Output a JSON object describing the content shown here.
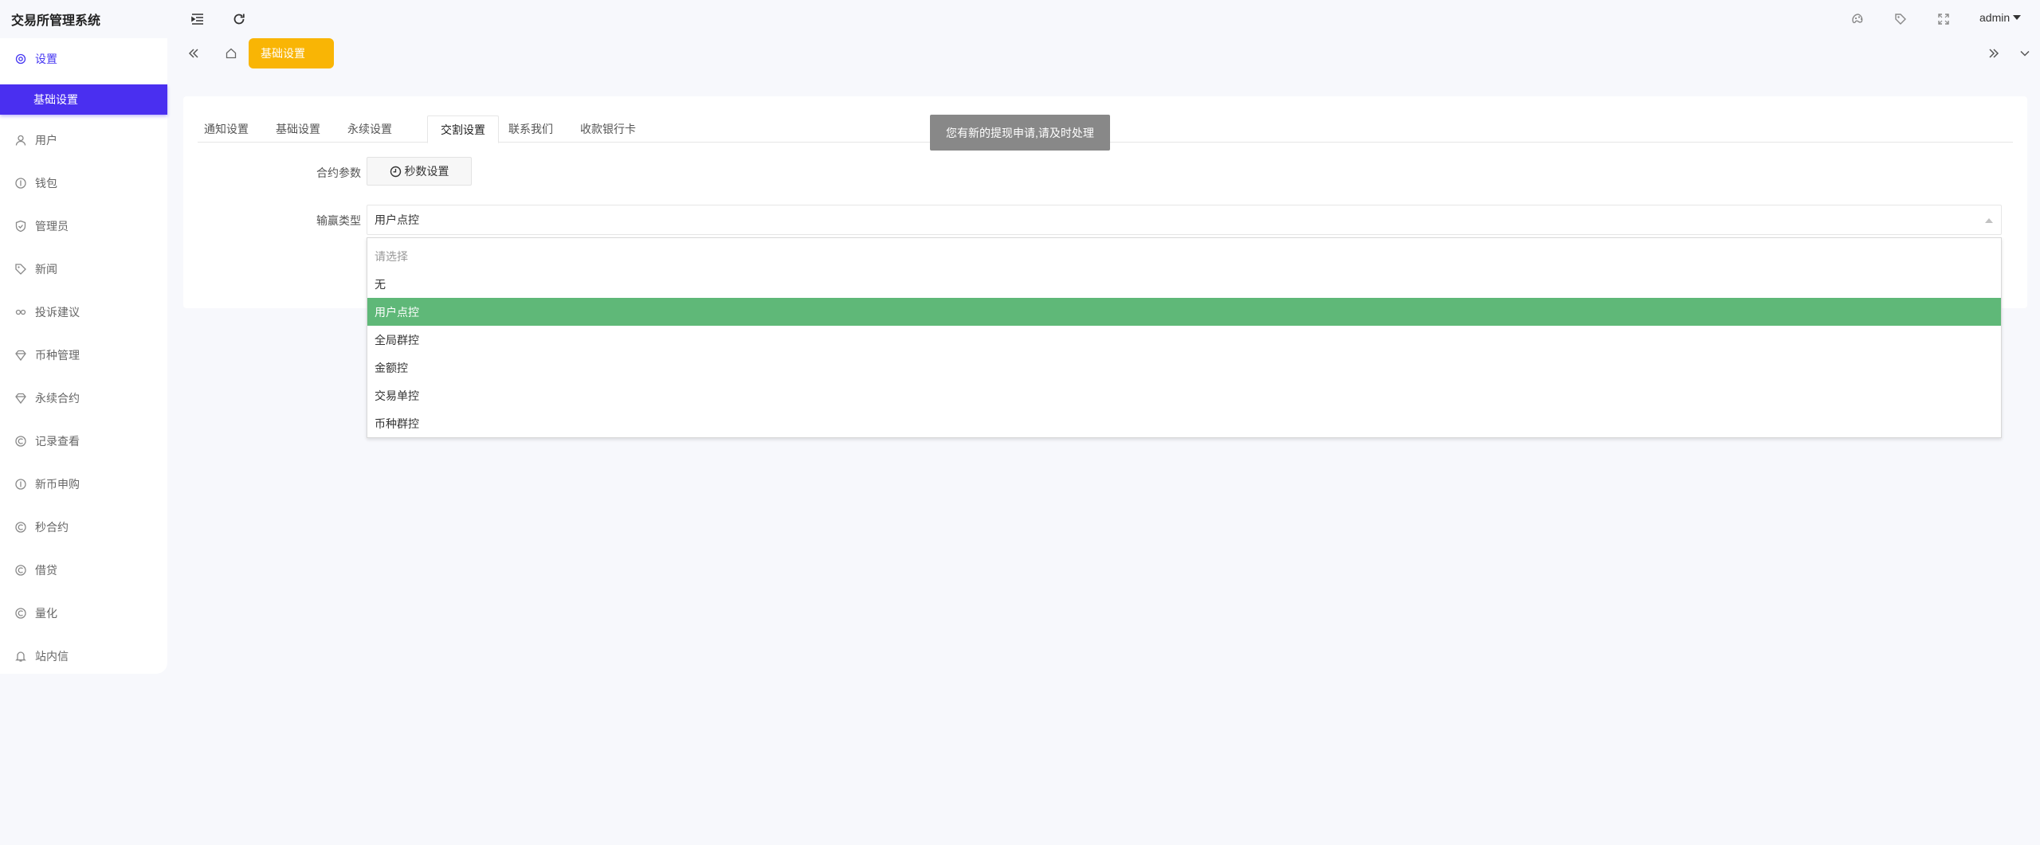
{
  "app": {
    "title": "交易所管理系统"
  },
  "header": {
    "icons": [
      "menu-fold-icon",
      "refresh-icon",
      "theme-icon",
      "tag-icon",
      "fullscreen-icon"
    ],
    "user": "admin"
  },
  "sidebar": {
    "top": {
      "label": "设置",
      "icon": "gear-icon"
    },
    "sub": {
      "label": "基础设置"
    },
    "items": [
      {
        "label": "用户",
        "icon": "user-icon"
      },
      {
        "label": "钱包",
        "icon": "coin-icon"
      },
      {
        "label": "管理员",
        "icon": "shield-icon"
      },
      {
        "label": "新闻",
        "icon": "tag-icon"
      },
      {
        "label": "投诉建议",
        "icon": "link-icon"
      },
      {
        "label": "币种管理",
        "icon": "diamond-icon"
      },
      {
        "label": "永续合约",
        "icon": "diamond-icon"
      },
      {
        "label": "记录查看",
        "icon": "coin-c-icon"
      },
      {
        "label": "新币申购",
        "icon": "coin-icon"
      },
      {
        "label": "秒合约",
        "icon": "coin-c-icon"
      },
      {
        "label": "借贷",
        "icon": "coin-c-icon"
      },
      {
        "label": "量化",
        "icon": "coin-c-icon"
      },
      {
        "label": "站内信",
        "icon": "bell-icon"
      }
    ]
  },
  "tabbar": {
    "current": "基础设置"
  },
  "tabs": [
    {
      "label": "通知设置"
    },
    {
      "label": "基础设置"
    },
    {
      "label": "永续设置"
    },
    {
      "label": "交割设置"
    },
    {
      "label": "联系我们"
    },
    {
      "label": "收款银行卡"
    }
  ],
  "form": {
    "contract_label": "合约参数",
    "seconds_button": "秒数设置",
    "win_type_label": "输赢类型",
    "win_type_value": "用户点控"
  },
  "dropdown": {
    "options": [
      "请选择",
      "无",
      "用户点控",
      "全局群控",
      "金额控",
      "交易单控",
      "币种群控"
    ],
    "selected": "用户点控"
  },
  "toast": {
    "message": "您有新的提现申请,请及时处理"
  }
}
